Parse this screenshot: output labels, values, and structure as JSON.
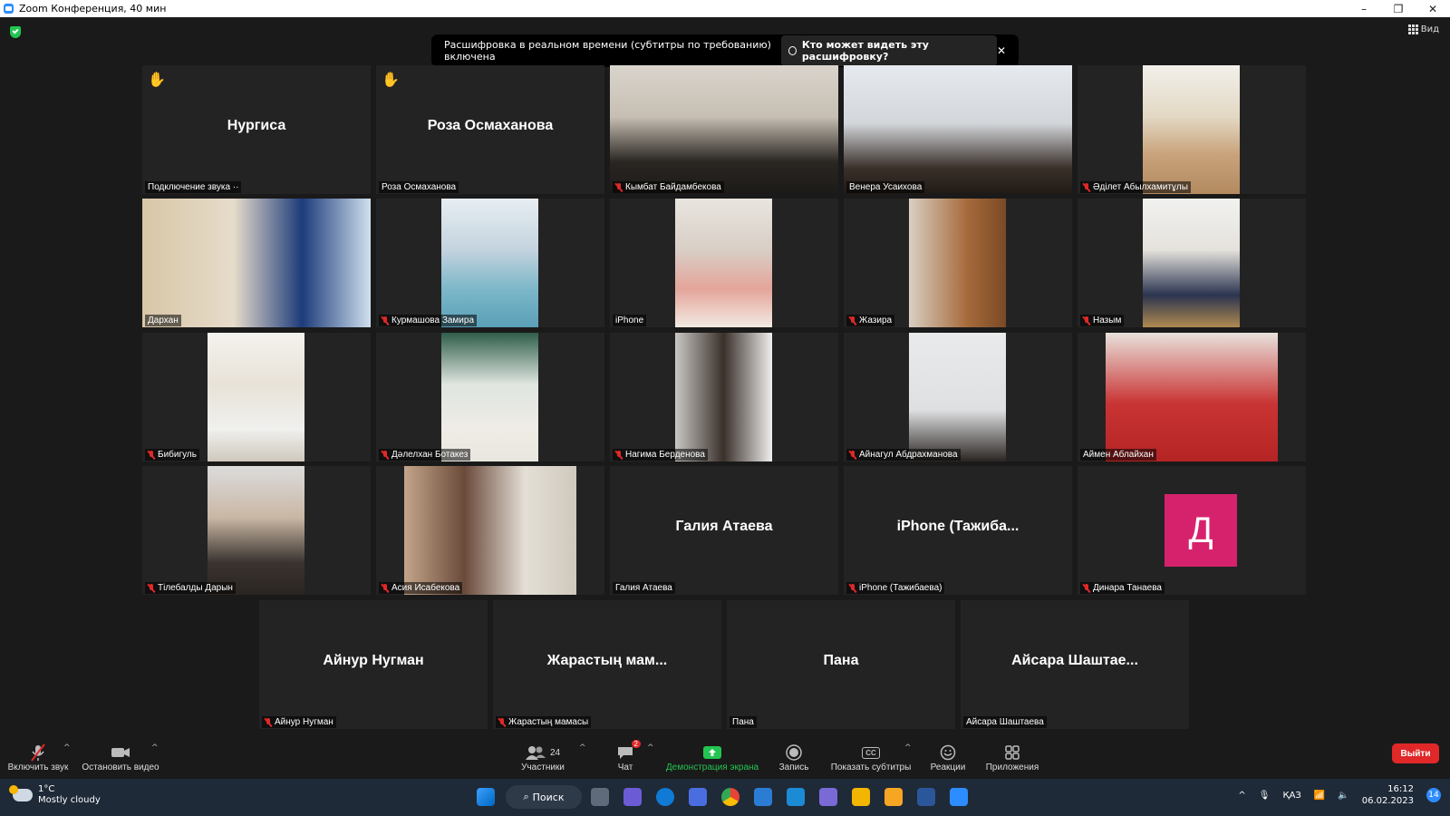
{
  "window": {
    "title": "Zoom Конференция, 40 мин",
    "minimize": "–",
    "restore": "❐",
    "close": "✕"
  },
  "top": {
    "view_label": "Вид"
  },
  "banner": {
    "text": "Расшифровка в реальном времени (субтитры по требованию) включена",
    "who_label": "Кто может видеть эту расшифровку?",
    "close": "✕"
  },
  "participants": [
    {
      "big": "Нургиса",
      "label": "Подключение звука ··",
      "muted": false,
      "hand": true
    },
    {
      "big": "Роза Осмаханова",
      "label": "Роза Осмаханова",
      "muted": false,
      "hand": true
    },
    {
      "big": "",
      "label": "Кымбат Байдамбекова",
      "muted": true
    },
    {
      "big": "",
      "label": "Венера Усаихова",
      "muted": false,
      "active": true
    },
    {
      "big": "",
      "label": "Әділет Абылхамитұлы",
      "muted": true
    },
    {
      "big": "",
      "label": "Дархан",
      "muted": false
    },
    {
      "big": "",
      "label": "Курмашова Замира",
      "muted": true
    },
    {
      "big": "",
      "label": "iPhone",
      "muted": false
    },
    {
      "big": "",
      "label": "Жазира",
      "muted": true
    },
    {
      "big": "",
      "label": "Назым",
      "muted": true
    },
    {
      "big": "",
      "label": "Бибигуль",
      "muted": true
    },
    {
      "big": "",
      "label": "Дәлелхан Ботакез",
      "muted": true
    },
    {
      "big": "",
      "label": "Нагима Берденова",
      "muted": true
    },
    {
      "big": "",
      "label": "Айнагул Абдрахманова",
      "muted": true
    },
    {
      "big": "",
      "label": "Аймен Аблайхан",
      "muted": false
    },
    {
      "big": "",
      "label": "Тілебалды Дарын",
      "muted": true
    },
    {
      "big": "",
      "label": "Асия Исабекова",
      "muted": true
    },
    {
      "big": "Галия Атаева",
      "label": "Галия Атаева",
      "muted": false
    },
    {
      "big": "iPhone (Тажиба...",
      "label": "iPhone (Тажибаева)",
      "muted": true
    },
    {
      "big": "",
      "initial": "Д",
      "label": "Динара Танаева",
      "muted": true
    },
    {
      "big": "Айнур Нугман",
      "label": "Айнур Нугман",
      "muted": true
    },
    {
      "big": "Жарастың мам...",
      "label": "Жарастың мамасы",
      "muted": true
    },
    {
      "big": "Пана",
      "label": "Пана",
      "muted": false
    },
    {
      "big": "Айсара Шаштае...",
      "label": "Айсара Шаштаева",
      "muted": false
    }
  ],
  "toolbar": {
    "unmute": "Включить звук",
    "stop_video": "Остановить видео",
    "participants": "Участники",
    "participants_count": "24",
    "chat": "Чат",
    "chat_badge": "2",
    "share": "Демонстрация экрана",
    "record": "Запись",
    "captions": "Показать субтитры",
    "captions_icon_text": "CC",
    "reactions": "Реакции",
    "apps": "Приложения",
    "leave": "Выйти"
  },
  "taskbar": {
    "temp": "1°C",
    "weather": "Mostly cloudy",
    "search": "Поиск",
    "lang": "ҚАЗ",
    "time": "16:12",
    "date": "06.02.2023",
    "notif": "14"
  },
  "colors": {
    "active_border": "#e9f78a",
    "share_green": "#23c552",
    "leave_red": "#e02828",
    "initial_bg": "#d6226d"
  }
}
